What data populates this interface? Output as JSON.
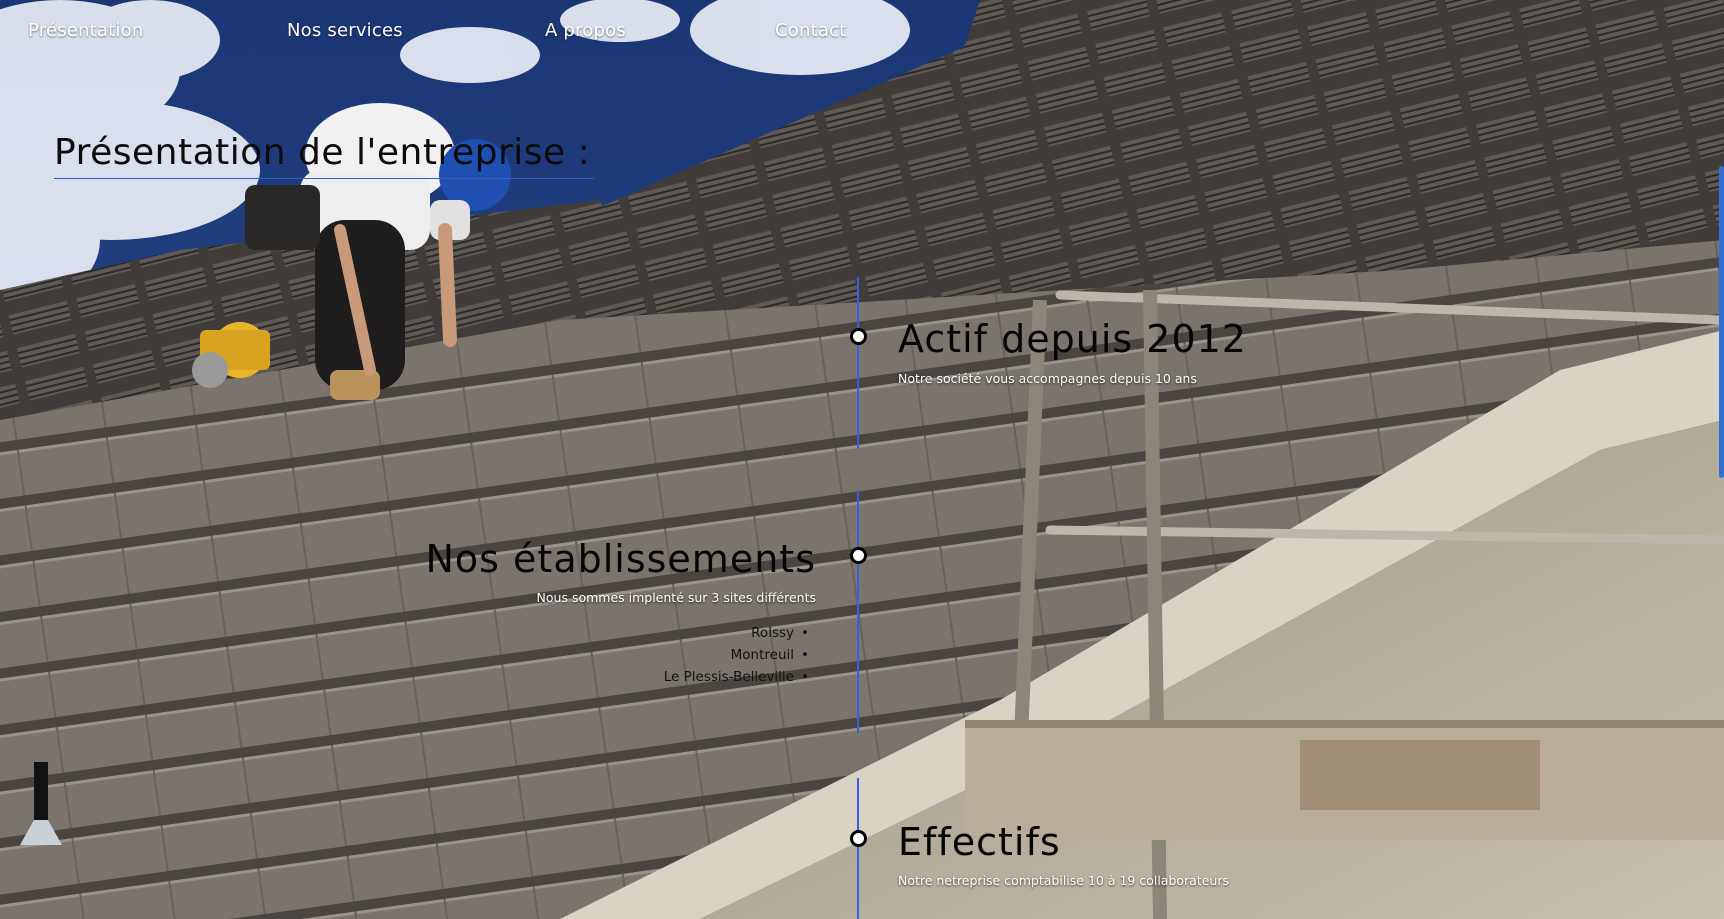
{
  "nav": {
    "items": [
      "Présentation",
      "Nos services",
      "A propos",
      "Contact"
    ]
  },
  "page": {
    "title": "Présentation de l'entreprise :"
  },
  "timeline": [
    {
      "heading": "Actif depuis 2012",
      "text": "Notre société vous accompagnes depuis 10 ans"
    },
    {
      "heading": "Nos établissements",
      "text": "Nous sommes implenté sur 3 sites différents",
      "sites": [
        "Roissy",
        "Montreuil",
        "Le Plessis-Belleville"
      ]
    },
    {
      "heading": "Effectifs",
      "text": "Notre netreprise comptabilise 10 à 19 collaborateurs"
    }
  ],
  "colors": {
    "accent": "#3a5fd9",
    "sky": "#1c3a7a",
    "roof": "#77716a"
  }
}
